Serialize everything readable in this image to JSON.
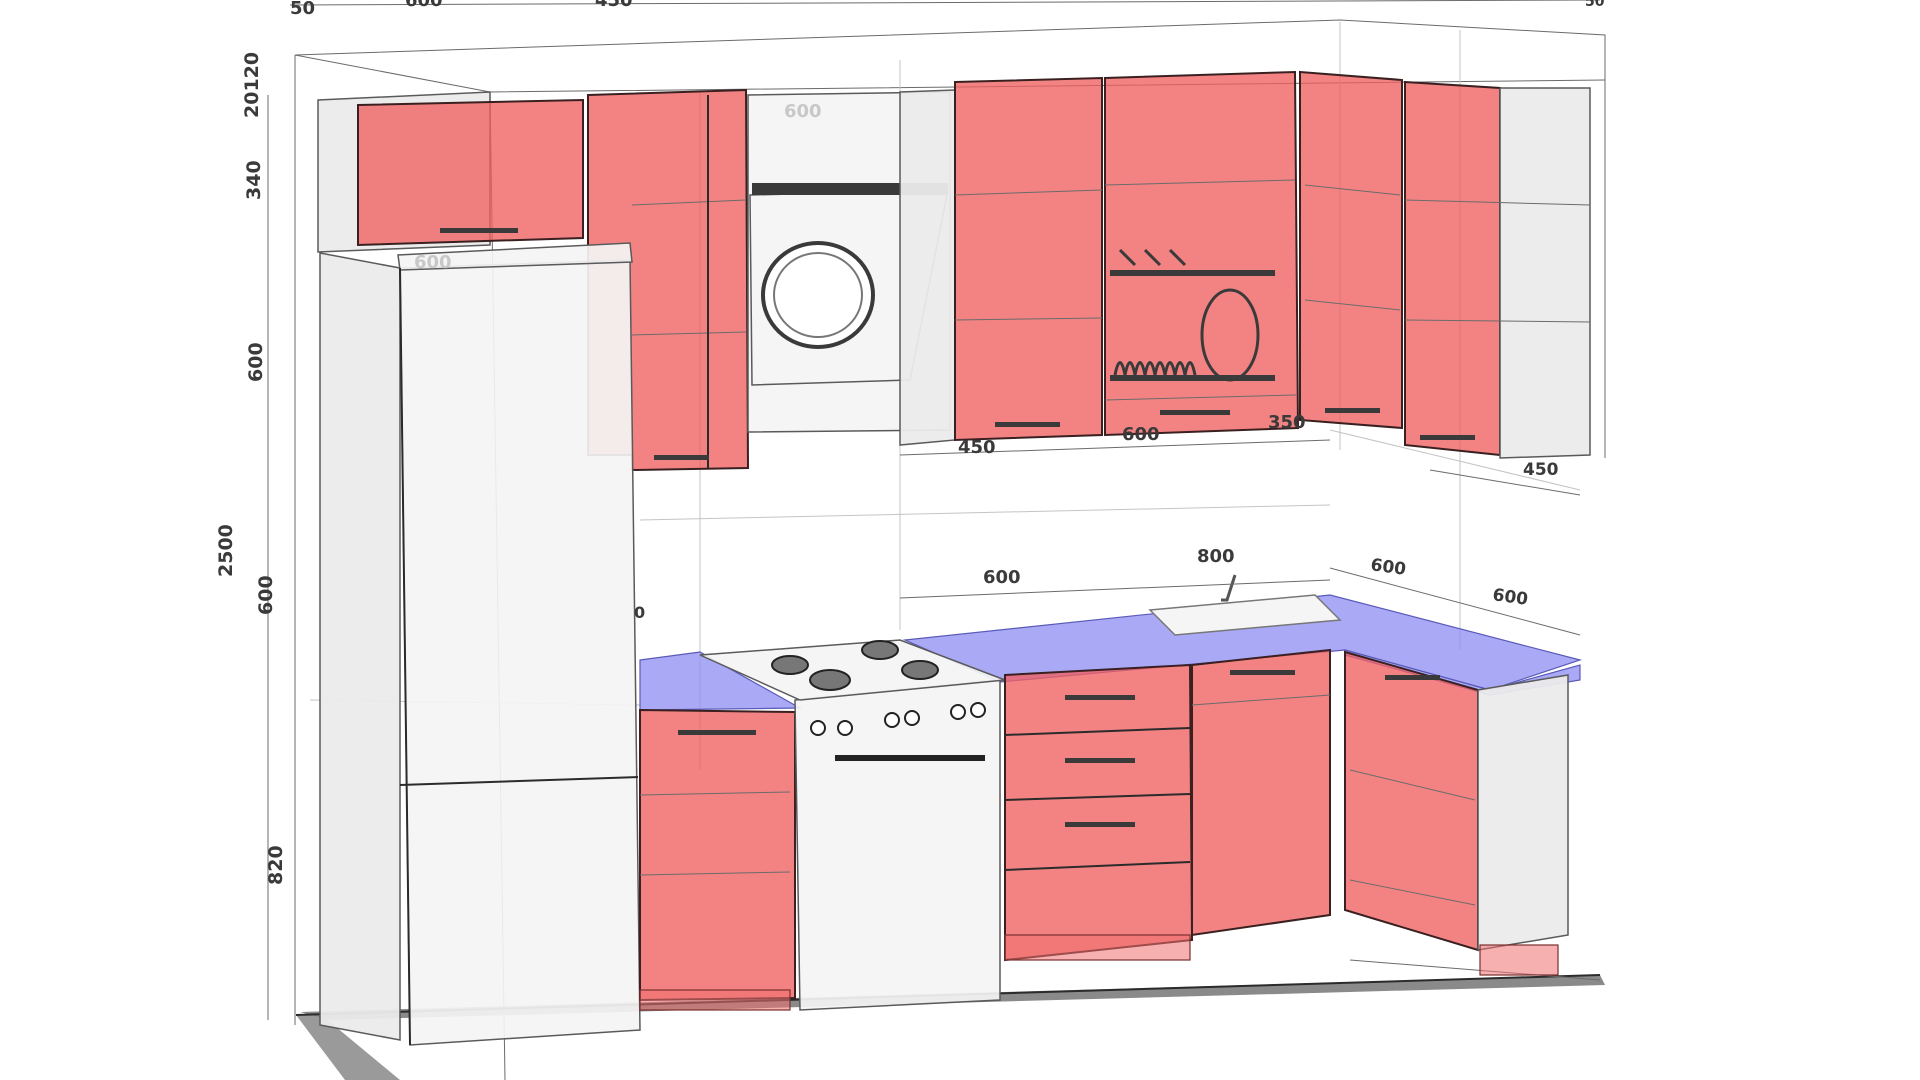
{
  "colors": {
    "cabinet": "#f06060",
    "countertop": "#8c8cf2",
    "appliance": "#f4f4f4",
    "lines": "#2b2b2b"
  },
  "dimensions": {
    "top": [
      "50",
      "600",
      "450",
      "50"
    ],
    "left": [
      "20120",
      "340",
      "600",
      "2500",
      "600",
      "820"
    ],
    "hood_width": "600",
    "fridge_width": "600",
    "upper_bottom": [
      "450",
      "600",
      "350",
      "450"
    ],
    "counter_top": [
      "800",
      "600",
      "600",
      "600"
    ],
    "partial_left": "0"
  }
}
